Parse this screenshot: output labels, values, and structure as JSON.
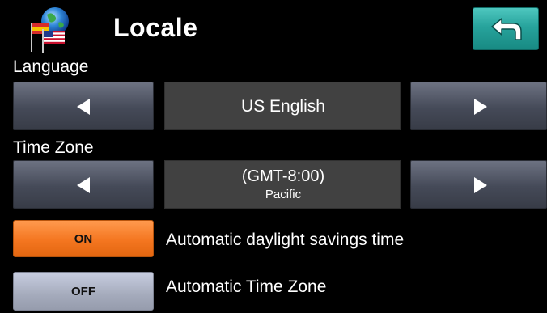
{
  "header": {
    "title": "Locale",
    "globe_icon": "globe-flags-icon",
    "back_icon": "back-arrow-icon"
  },
  "language": {
    "label": "Language",
    "value": "US English",
    "prev_icon": "arrow-left-icon",
    "next_icon": "arrow-right-icon"
  },
  "time_zone": {
    "label": "Time Zone",
    "value_line1": "(GMT-8:00)",
    "value_line2": "Pacific",
    "prev_icon": "arrow-left-icon",
    "next_icon": "arrow-right-icon"
  },
  "options": {
    "daylight_savings": {
      "state": "ON",
      "label": "Automatic daylight savings time",
      "color": "#f47620"
    },
    "auto_time_zone": {
      "state": "OFF",
      "label": "Automatic Time Zone",
      "color": "#a5abbc"
    }
  },
  "colors": {
    "background": "#000000",
    "back_button": "#27a39c",
    "value_box": "#414141",
    "arrow_button": "#454a58"
  }
}
